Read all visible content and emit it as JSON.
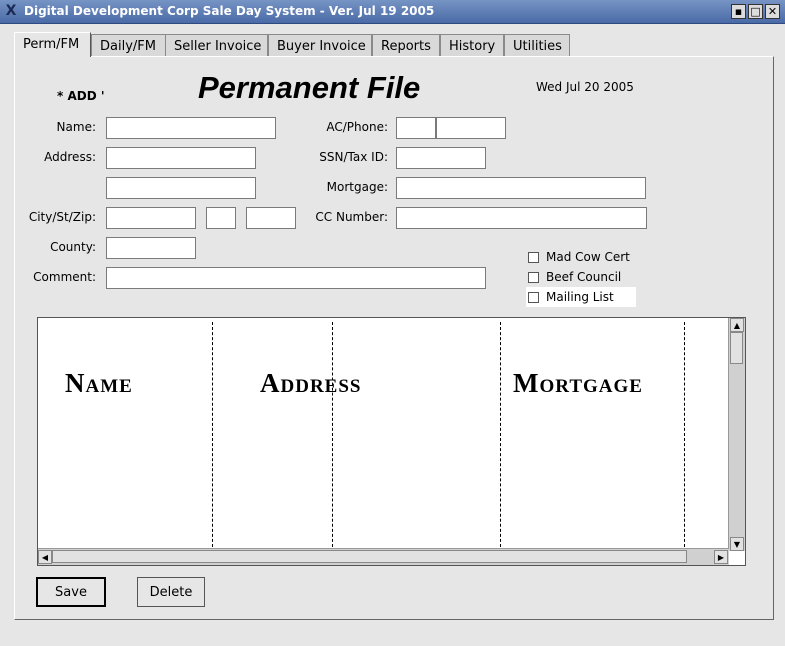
{
  "window": {
    "title": "Digital Development Corp Sale Day System - Ver. Jul 19 2005",
    "app_icon": "X",
    "minimize_glyph": "▪",
    "maximize_glyph": "□",
    "close_glyph": "✕"
  },
  "tabs": [
    {
      "label": "Perm/FM",
      "active": true
    },
    {
      "label": "Daily/FM"
    },
    {
      "label": "Seller Invoice"
    },
    {
      "label": "Buyer Invoice"
    },
    {
      "label": "Reports"
    },
    {
      "label": "History"
    },
    {
      "label": "Utilities"
    }
  ],
  "header": {
    "mode": "* ADD '",
    "title": "Permanent File",
    "date": "Wed  Jul 20 2005"
  },
  "form": {
    "name_label": "Name:",
    "address_label": "Address:",
    "city_label": "City/St/Zip:",
    "county_label": "County:",
    "comment_label": "Comment:",
    "acphone_label": "AC/Phone:",
    "ssn_label": "SSN/Tax ID:",
    "mortgage_label": "Mortgage:",
    "cc_label": "CC Number:",
    "name": "",
    "address1": "",
    "address2": "",
    "city": "",
    "state": "",
    "zip": "",
    "county": "",
    "comment": "",
    "area_code": "",
    "phone": "",
    "ssn": "",
    "mortgage": "",
    "cc_number": ""
  },
  "checkboxes": [
    {
      "label": "Mad Cow Cert",
      "checked": false
    },
    {
      "label": "Beef Council",
      "checked": false
    },
    {
      "label": "Mailing List",
      "checked": false
    }
  ],
  "grid": {
    "columns": [
      "Name",
      "Address",
      "Mortgage"
    ]
  },
  "buttons": {
    "save": "Save",
    "delete": "Delete"
  }
}
